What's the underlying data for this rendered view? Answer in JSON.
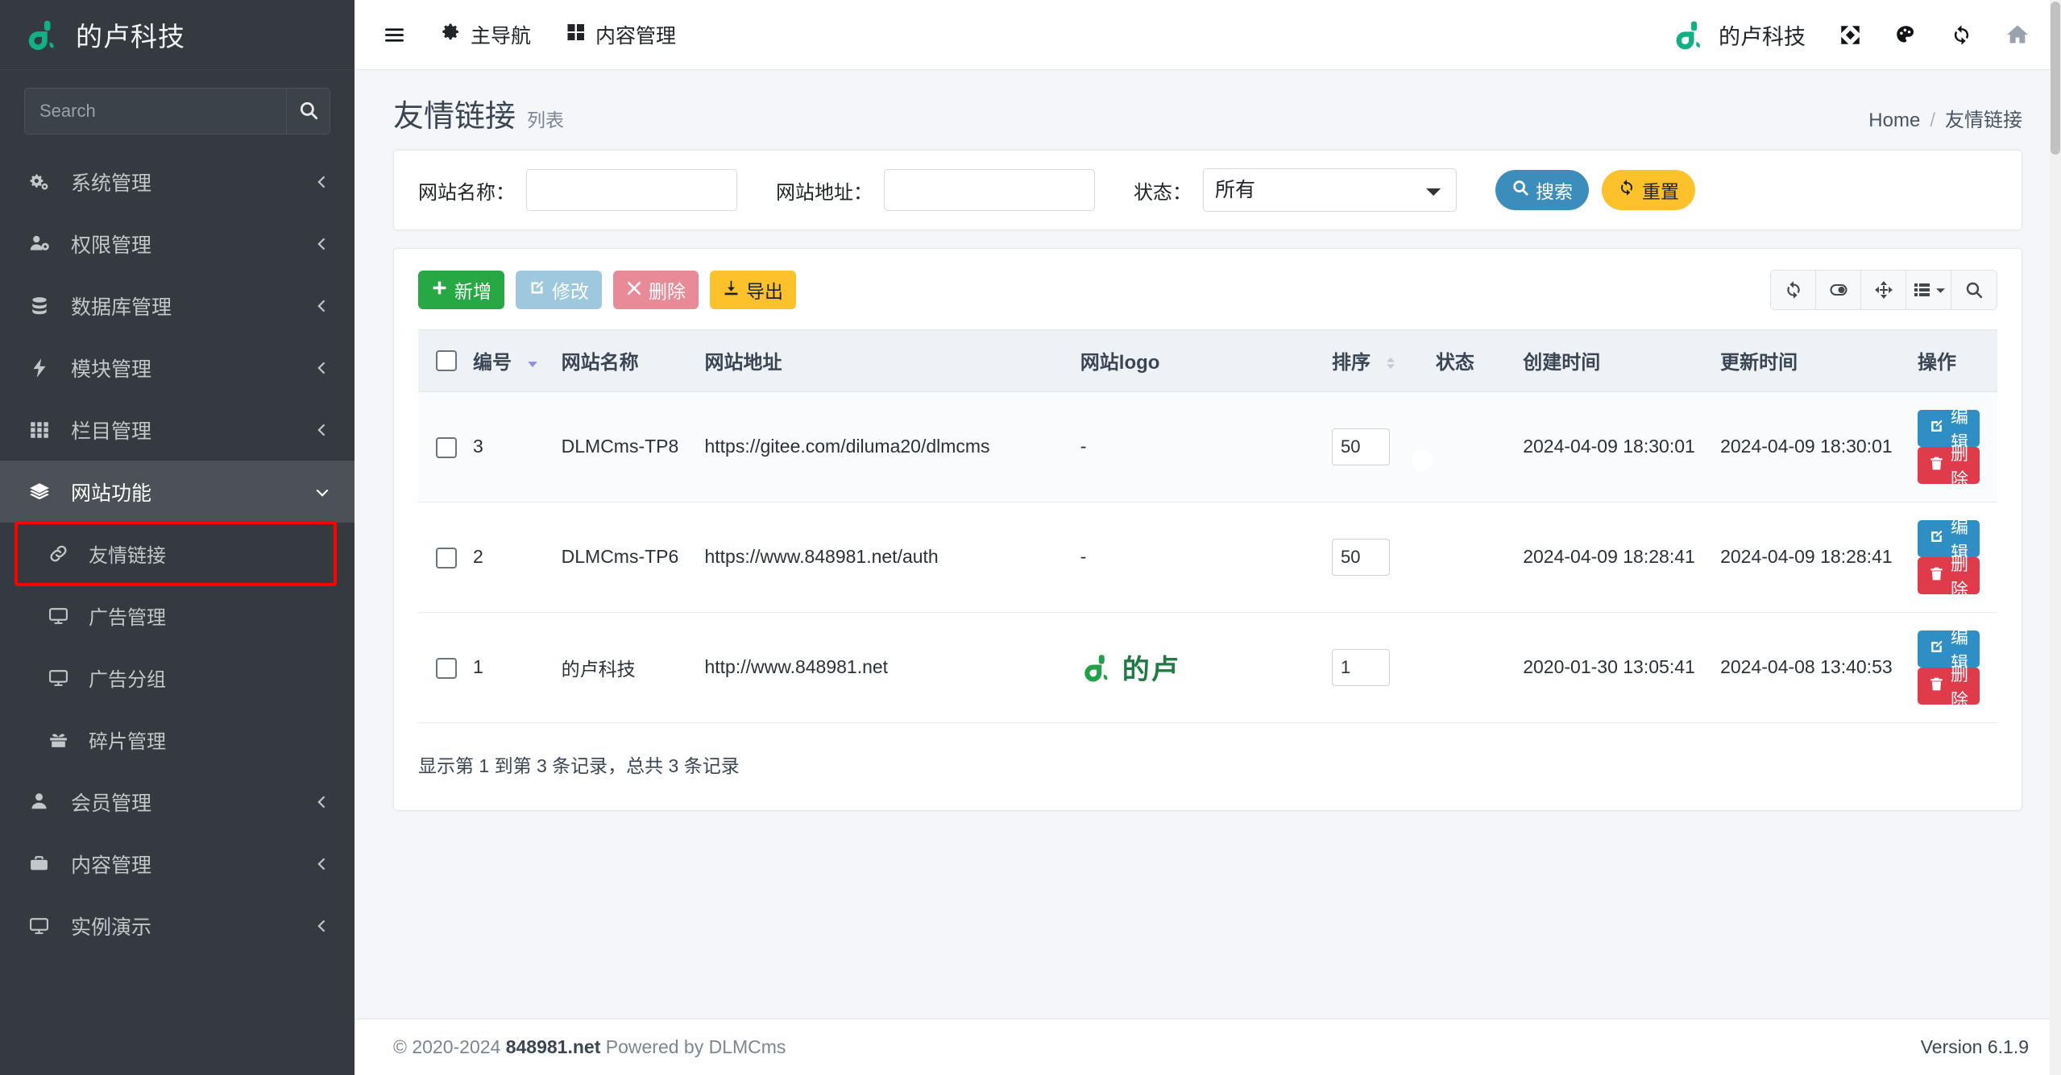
{
  "brand": {
    "title": "的卢科技",
    "logo_icon": "dilu-logo",
    "logo_color": "#13b083"
  },
  "sidebar": {
    "search": {
      "placeholder": "Search",
      "icon": "search-icon",
      "value": ""
    },
    "items": [
      {
        "label": "系统管理",
        "icon": "gears-icon",
        "caret": "chevron-left-icon",
        "level": "top",
        "state": "collapsed"
      },
      {
        "label": "权限管理",
        "icon": "user-gear-icon",
        "caret": "chevron-left-icon",
        "level": "top",
        "state": "collapsed"
      },
      {
        "label": "数据库管理",
        "icon": "database-icon",
        "caret": "chevron-left-icon",
        "level": "top",
        "state": "collapsed"
      },
      {
        "label": "模块管理",
        "icon": "bolt-icon",
        "caret": "chevron-left-icon",
        "level": "top",
        "state": "collapsed"
      },
      {
        "label": "栏目管理",
        "icon": "grid-icon",
        "caret": "chevron-left-icon",
        "level": "top",
        "state": "collapsed"
      },
      {
        "label": "网站功能",
        "icon": "layers-icon",
        "caret": "chevron-down-icon",
        "level": "top",
        "state": "active-expanded"
      },
      {
        "label": "友情链接",
        "icon": "link-icon",
        "caret": "",
        "level": "sub",
        "state": "highlighted"
      },
      {
        "label": "广告管理",
        "icon": "desktop-icon",
        "caret": "",
        "level": "sub",
        "state": "normal"
      },
      {
        "label": "广告分组",
        "icon": "desktop-icon",
        "caret": "",
        "level": "sub",
        "state": "normal"
      },
      {
        "label": "碎片管理",
        "icon": "gift-icon",
        "caret": "",
        "level": "sub",
        "state": "normal"
      },
      {
        "label": "会员管理",
        "icon": "user-icon",
        "caret": "chevron-left-icon",
        "level": "top",
        "state": "collapsed"
      },
      {
        "label": "内容管理",
        "icon": "briefcase-icon",
        "caret": "chevron-left-icon",
        "level": "top",
        "state": "collapsed"
      },
      {
        "label": "实例演示",
        "icon": "tv-icon",
        "caret": "chevron-left-icon",
        "level": "top",
        "state": "collapsed"
      }
    ]
  },
  "navbar": {
    "menu_toggle_icon": "hamburger-icon",
    "links": [
      {
        "label": "主导航",
        "icon": "gear-icon"
      },
      {
        "label": "内容管理",
        "icon": "grid-4-icon"
      }
    ],
    "brand_label": "的卢科技",
    "icons": [
      "expand-arrows-icon",
      "palette-icon",
      "refresh-icon",
      "home-icon"
    ]
  },
  "page": {
    "title": "友情链接",
    "subtitle": "列表",
    "breadcrumb": {
      "home": "Home",
      "separator": "/",
      "current": "友情链接"
    }
  },
  "filter": {
    "name_label": "网站名称：",
    "name_value": "",
    "url_label": "网站地址：",
    "url_value": "",
    "status_label": "状态：",
    "status_value": "所有",
    "status_options": [
      "所有"
    ],
    "search_button": "搜索",
    "reset_button": "重置",
    "search_icon": "search-icon",
    "reset_icon": "refresh-icon"
  },
  "toolbar": {
    "buttons": [
      {
        "label": "新增",
        "icon": "plus-icon",
        "color": "#27a844"
      },
      {
        "label": "修改",
        "icon": "edit-icon",
        "color": "#9dc8de"
      },
      {
        "label": "删除",
        "icon": "times-icon",
        "color": "#e98a98"
      },
      {
        "label": "导出",
        "icon": "download-icon",
        "color": "#fcc12b"
      }
    ],
    "right_icons": [
      "refresh-icon",
      "toggle-icon",
      "fullscreen-icon",
      "columns-icon",
      "search-icon"
    ]
  },
  "table": {
    "headers": {
      "checkbox": "",
      "id": "编号",
      "name": "网站名称",
      "url": "网站地址",
      "logo": "网站logo",
      "sort": "排序",
      "status": "状态",
      "created": "创建时间",
      "updated": "更新时间",
      "actions": "操作"
    },
    "sort_state": {
      "id": "desc",
      "sort": "none"
    },
    "rows": [
      {
        "id": "3",
        "name": "DLMCms-TP8",
        "url": "https://gitee.com/diluma20/dlmcms",
        "logo": "-",
        "logo_type": "text",
        "sort": "50",
        "status": true,
        "created": "2024-04-09 18:30:01",
        "updated": "2024-04-09 18:30:01",
        "edit": "编辑",
        "delete": "删除"
      },
      {
        "id": "2",
        "name": "DLMCms-TP6",
        "url": "https://www.848981.net/auth",
        "logo": "-",
        "logo_type": "text",
        "sort": "50",
        "status": true,
        "created": "2024-04-09 18:28:41",
        "updated": "2024-04-09 18:28:41",
        "edit": "编辑",
        "delete": "删除"
      },
      {
        "id": "1",
        "name": "的卢科技",
        "url": "http://www.848981.net",
        "logo": "的卢",
        "logo_type": "image",
        "sort": "1",
        "status": true,
        "created": "2020-01-30 13:05:41",
        "updated": "2024-04-08 13:40:53",
        "edit": "编辑",
        "delete": "删除"
      }
    ],
    "summary": "显示第 1 到第 3 条记录，总共 3 条记录"
  },
  "footer": {
    "copyright_prefix": "© 2020-2024 ",
    "copyright_strong": "848981.net",
    "copyright_suffix": " Powered by DLMCms",
    "version": "Version 6.1.9"
  }
}
